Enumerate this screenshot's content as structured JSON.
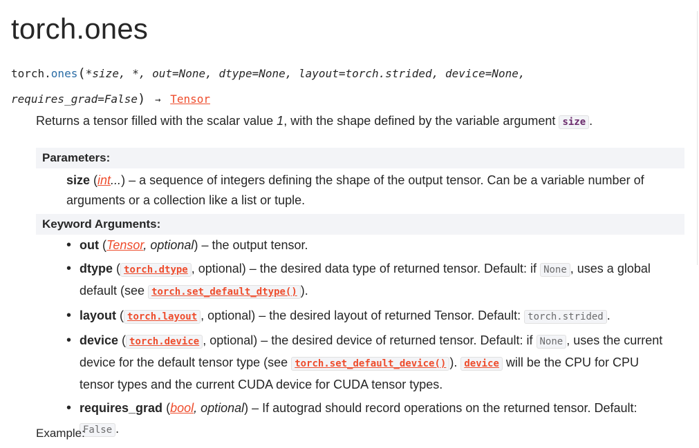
{
  "title": "torch.ones",
  "signature": {
    "prefix": "torch.",
    "name": "ones",
    "open_paren": "(",
    "params_line1": "*size, *, out=None, dtype=None, layout=torch.strided, device=None,",
    "params_line2": "requires_grad=False",
    "close_paren": ")",
    "arrow": "→",
    "return_type": "Tensor"
  },
  "description": {
    "text_a": "Returns a tensor filled with the scalar value ",
    "value": "1",
    "text_b": ", with the shape defined by the variable argument ",
    "code": "size",
    "text_c": "."
  },
  "parameters": {
    "header": "Parameters:",
    "items": [
      {
        "name": "size",
        "open": " (",
        "type_link": "int",
        "type_suffix": "...",
        "close": ")",
        "dash": " – ",
        "desc": "a sequence of integers defining the shape of the output tensor. Can be a variable number of arguments or a collection like a list or tuple."
      }
    ]
  },
  "keyword_arguments": {
    "header": "Keyword Arguments:",
    "items": [
      {
        "name": "out",
        "type_link": "Tensor",
        "optional": ", optional",
        "desc": " – the output tensor."
      },
      {
        "name": "dtype",
        "code_link": "torch.dtype",
        "optional": ", optional",
        "desc_a": " – the desired data type of returned tensor. Default: if ",
        "code_a": "None",
        "desc_b": ", uses a global default (see ",
        "code_link_b": "torch.set_default_dtype()",
        "desc_c": ")."
      },
      {
        "name": "layout",
        "code_link": "torch.layout",
        "optional": ", optional",
        "desc_a": " – the desired layout of returned Tensor. Default: ",
        "code_a": "torch.strided",
        "desc_b": "."
      },
      {
        "name": "device",
        "code_link": "torch.device",
        "optional": ", optional",
        "desc_a": " – the desired device of returned tensor. Default: if ",
        "code_a": "None",
        "desc_b": ", uses the current device for the default tensor type (see ",
        "code_link_b": "torch.set_default_device()",
        "desc_c": "). ",
        "code_link_c": "device",
        "desc_d": " will be the CPU for CPU tensor types and the current CUDA device for CUDA tensor types."
      },
      {
        "name": "requires_grad",
        "type_link": "bool",
        "optional": ", optional",
        "desc_a": " – If autograd should record operations on the returned tensor. Default: ",
        "code_a": "False",
        "desc_b": "."
      }
    ]
  },
  "example_label": "Example:",
  "colors": {
    "link": "#ee4c2c",
    "function_name": "#2a6ca5",
    "header_background": "#f3f4f7",
    "text": "#262626"
  }
}
